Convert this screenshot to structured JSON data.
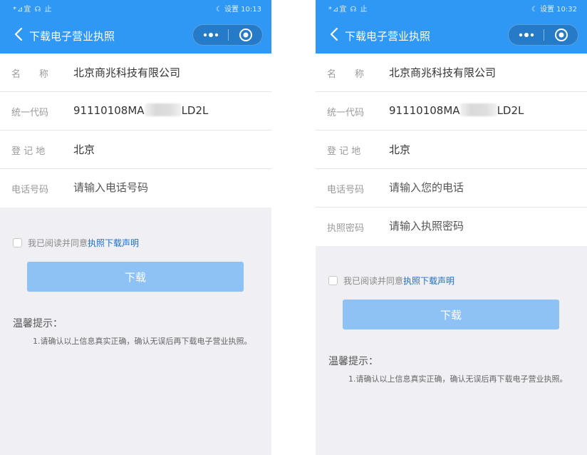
{
  "left": {
    "status": {
      "left": "*⊿宜 ☊ 止",
      "right": "☾ 设置 10:13"
    },
    "nav": {
      "title": "下载电子营业执照"
    },
    "fields": [
      {
        "label": "名　　称",
        "value": "北京商兆科技有限公司"
      },
      {
        "label": "统一代码",
        "value_prefix": "91110108MA",
        "value_suffix": "LD2L"
      },
      {
        "label": "登 记 地",
        "value": "北京"
      },
      {
        "label": "电话号码",
        "placeholder": "请输入电话号码"
      }
    ],
    "agree": {
      "text": "我已阅读并同意",
      "link": "执照下载声明"
    },
    "download_label": "下载",
    "tips": {
      "title": "温馨提示：",
      "text": "1.请确认以上信息真实正确，确认无误后再下载电子营业执照。"
    }
  },
  "right": {
    "status": {
      "left": "*⊿宜 ☊ 止",
      "right": "☾ 设置 10:32"
    },
    "nav": {
      "title": "下载电子营业执照"
    },
    "fields": [
      {
        "label": "名　　称",
        "value": "北京商兆科技有限公司"
      },
      {
        "label": "统一代码",
        "value_prefix": "91110108MA",
        "value_suffix": "LD2L"
      },
      {
        "label": "登 记 地",
        "value": "北京"
      },
      {
        "label": "电话号码",
        "placeholder": "请输入您的电话"
      },
      {
        "label": "执照密码",
        "placeholder": "请输入执照密码"
      }
    ],
    "agree": {
      "text": "我已阅读并同意",
      "link": "执照下载声明"
    },
    "download_label": "下载",
    "tips": {
      "title": "温馨提示：",
      "text": "1.请确认以上信息真实正确，确认无误后再下载电子营业执照。"
    }
  },
  "colors": {
    "header": "#2f97f4",
    "button": "#8ec2f5",
    "link": "#1f6fc1",
    "background": "#efeff4"
  },
  "icons": [
    "back-chevron-icon",
    "more-dots-icon",
    "target-close-icon",
    "checkbox-icon"
  ]
}
